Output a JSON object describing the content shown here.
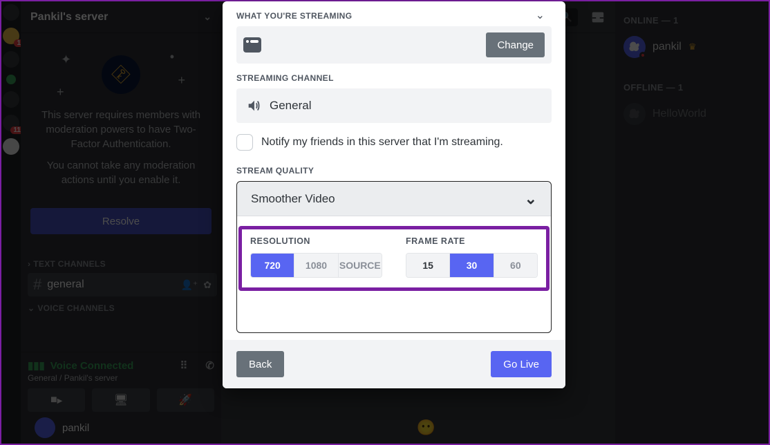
{
  "server": {
    "name": "Pankil's server"
  },
  "notice": {
    "line1": "This server requires members with moderation powers to have Two-Factor Authentication.",
    "line2": "You cannot take any moderation actions until you enable it.",
    "resolve": "Resolve"
  },
  "channels": {
    "text_header": "TEXT CHANNELS",
    "text_items": [
      {
        "name": "general"
      }
    ],
    "voice_header": "VOICE CHANNELS"
  },
  "voice_panel": {
    "status": "Voice Connected",
    "sub": "General / Pankil's server"
  },
  "current_user": {
    "name": "pankil"
  },
  "titlebar": {
    "search_placeholder": "Search"
  },
  "members": {
    "online_header": "ONLINE — 1",
    "online": [
      {
        "name": "pankil",
        "owner": true
      }
    ],
    "offline_header": "OFFLINE — 1",
    "offline": [
      {
        "name": "HelloWorld"
      }
    ]
  },
  "rail": {
    "badge1": "1",
    "badge2": "11"
  },
  "modal": {
    "what_label": "WHAT YOU'RE STREAMING",
    "change": "Change",
    "channel_label": "STREAMING CHANNEL",
    "channel_value": "General",
    "notify": "Notify my friends in this server that I'm streaming.",
    "quality_label": "STREAM QUALITY",
    "quality_select": "Smoother Video",
    "resolution_label": "RESOLUTION",
    "resolution_options": [
      "720",
      "1080",
      "SOURCE"
    ],
    "resolution_selected": "720",
    "framerate_label": "FRAME RATE",
    "framerate_options": [
      "15",
      "30",
      "60"
    ],
    "framerate_selected": "30",
    "framerate_available": [
      "15",
      "30"
    ],
    "back": "Back",
    "go_live": "Go Live"
  }
}
